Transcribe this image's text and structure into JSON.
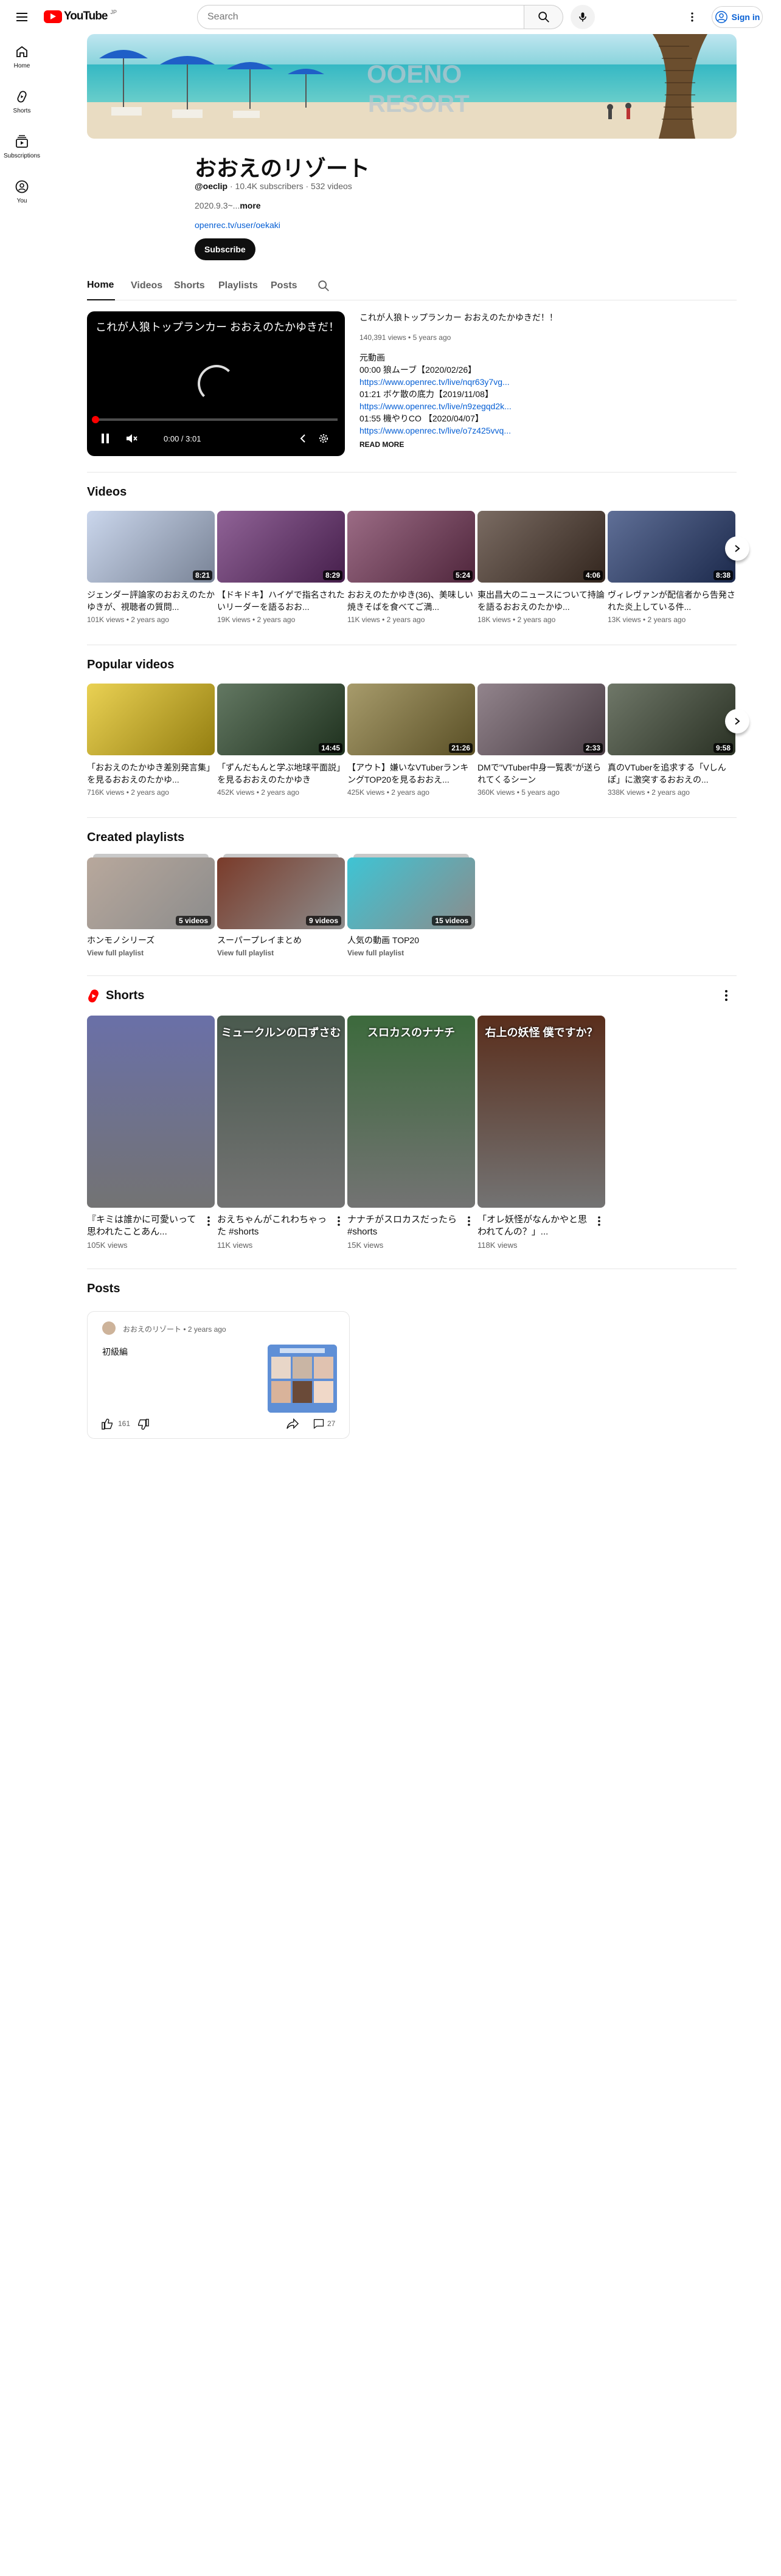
{
  "header": {
    "logo_text": "YouTube",
    "logo_region": "JP",
    "search_placeholder": "Search",
    "sign_in": "Sign in"
  },
  "guide": [
    {
      "label": "Home",
      "icon": "home-icon"
    },
    {
      "label": "Shorts",
      "icon": "shorts-icon"
    },
    {
      "label": "Subscriptions",
      "icon": "subscriptions-icon"
    },
    {
      "label": "You",
      "icon": "you-icon"
    }
  ],
  "channel": {
    "banner_text": "OOENO RESORT",
    "title": "おおえのリゾート",
    "handle": "@oeclip",
    "stats": " · 10.4K subscribers · 532 videos",
    "description": "2020.9.3~...",
    "more": "more",
    "link": "openrec.tv/user/oekaki",
    "subscribe": "Subscribe"
  },
  "tabs": [
    "Home",
    "Videos",
    "Shorts",
    "Playlists",
    "Posts"
  ],
  "featured": {
    "player_title": "これが人狼トップランカー おおえのたかゆきだ！！",
    "time": "0:00 / 3:01",
    "title": "これが人狼トップランカー おおえのたかゆきだ！！",
    "meta": "140,391 views • 5 years ago",
    "lines": [
      {
        "text": "元動画",
        "link": false
      },
      {
        "text": "00:00 狼ムーブ【2020/02/26】",
        "link": false
      },
      {
        "text": "https://www.openrec.tv/live/nqr63y7vg...",
        "link": true
      },
      {
        "text": "01:21 ボケ散の底力【2019/11/08】",
        "link": false
      },
      {
        "text": "https://www.openrec.tv/live/n9zegqd2k...",
        "link": true
      },
      {
        "text": "01:55 機やりCO 【2020/04/07】",
        "link": false
      },
      {
        "text": "https://www.openrec.tv/live/o7z425vvq...",
        "link": true
      }
    ],
    "read_more": "READ MORE"
  },
  "sections": {
    "videos": "Videos",
    "popular": "Popular videos",
    "playlists": "Created playlists",
    "shorts": "Shorts",
    "posts": "Posts"
  },
  "videos": [
    {
      "title": "ジェンダー評論家のおおえのたかゆきが、視聴者の質問...",
      "meta": "101K views • 2 years ago",
      "duration": "8:21",
      "color": "#b9c9e6"
    },
    {
      "title": "【ドキドキ】ハイゲで指名されたいリーダーを語るおお...",
      "meta": "19K views • 2 years ago",
      "duration": "8:29",
      "color": "#6b2f74"
    },
    {
      "title": "おおえのたかゆき(36)、美味しい焼きそばを食べてご満...",
      "meta": "11K views • 2 years ago",
      "duration": "5:24",
      "color": "#7a3a5c"
    },
    {
      "title": "東出昌大のニュースについて持論を語るおおえのたかゆ...",
      "meta": "18K views • 2 years ago",
      "duration": "4:06",
      "color": "#4e3a2e"
    },
    {
      "title": "ヴィレヴァンが配信者から告発された炎上している件...",
      "meta": "13K views • 2 years ago",
      "duration": "8:38",
      "color": "#2a3f74"
    }
  ],
  "popular": [
    {
      "title": "「おおえのたかゆき差別発言集」を見るおおえのたかゆ...",
      "meta": "716K views • 2 years ago",
      "duration": "",
      "color": "#e3c21a"
    },
    {
      "title": "「ずんだもんと学ぶ地球平面説」を見るおおえのたかゆき",
      "meta": "452K views • 2 years ago",
      "duration": "14:45",
      "color": "#2f4b2e"
    },
    {
      "title": "【アウト】嫌いなVTuberランキングTOP20を見るおおえ...",
      "meta": "425K views • 2 years ago",
      "duration": "21:26",
      "color": "#8a7a3a"
    },
    {
      "title": "DMで\"VTuber中身一覧表\"が送られてくるシーン",
      "meta": "360K views • 5 years ago",
      "duration": "2:33",
      "color": "#6e5b66"
    },
    {
      "title": "真のVTuberを追求する「Vしんぽ」に激突するおおえの...",
      "meta": "338K views • 2 years ago",
      "duration": "9:58",
      "color": "#3f4a36"
    }
  ],
  "playlists": [
    {
      "title": "ホンモノシリーズ",
      "count": "5 videos",
      "link": "View full playlist",
      "color": "#b8a89c"
    },
    {
      "title": "スーパープレイまとめ",
      "count": "9 videos",
      "link": "View full playlist",
      "color": "#7a3b2a"
    },
    {
      "title": "人気の動画 TOP20",
      "count": "15 videos",
      "link": "View full playlist",
      "color": "#3ec4d4"
    }
  ],
  "shorts": [
    {
      "title": "『キミは誰かに可愛いって思われたことあん...",
      "views": "105K views",
      "color": "#6a70a8"
    },
    {
      "title": "おえちゃんがこれわちゃった #shorts",
      "views": "11K views",
      "color": "#4a5a4e"
    },
    {
      "title": "ナナチがスロカスだったら #shorts",
      "views": "15K views",
      "color": "#3c6a3c"
    },
    {
      "title": "「オレ妖怪がなんかやと思われてんの？」...",
      "views": "118K views",
      "color": "#5a2e1c"
    }
  ],
  "shorts_overlays": [
    "",
    "ミュークルンの口ずさむ",
    "スロカスのナナチ",
    "右上の妖怪 僕ですか？"
  ],
  "post": {
    "author": "おおえのリゾート",
    "time": " • 2 years ago",
    "text": "初級編",
    "likes": "161",
    "comments": "27"
  }
}
